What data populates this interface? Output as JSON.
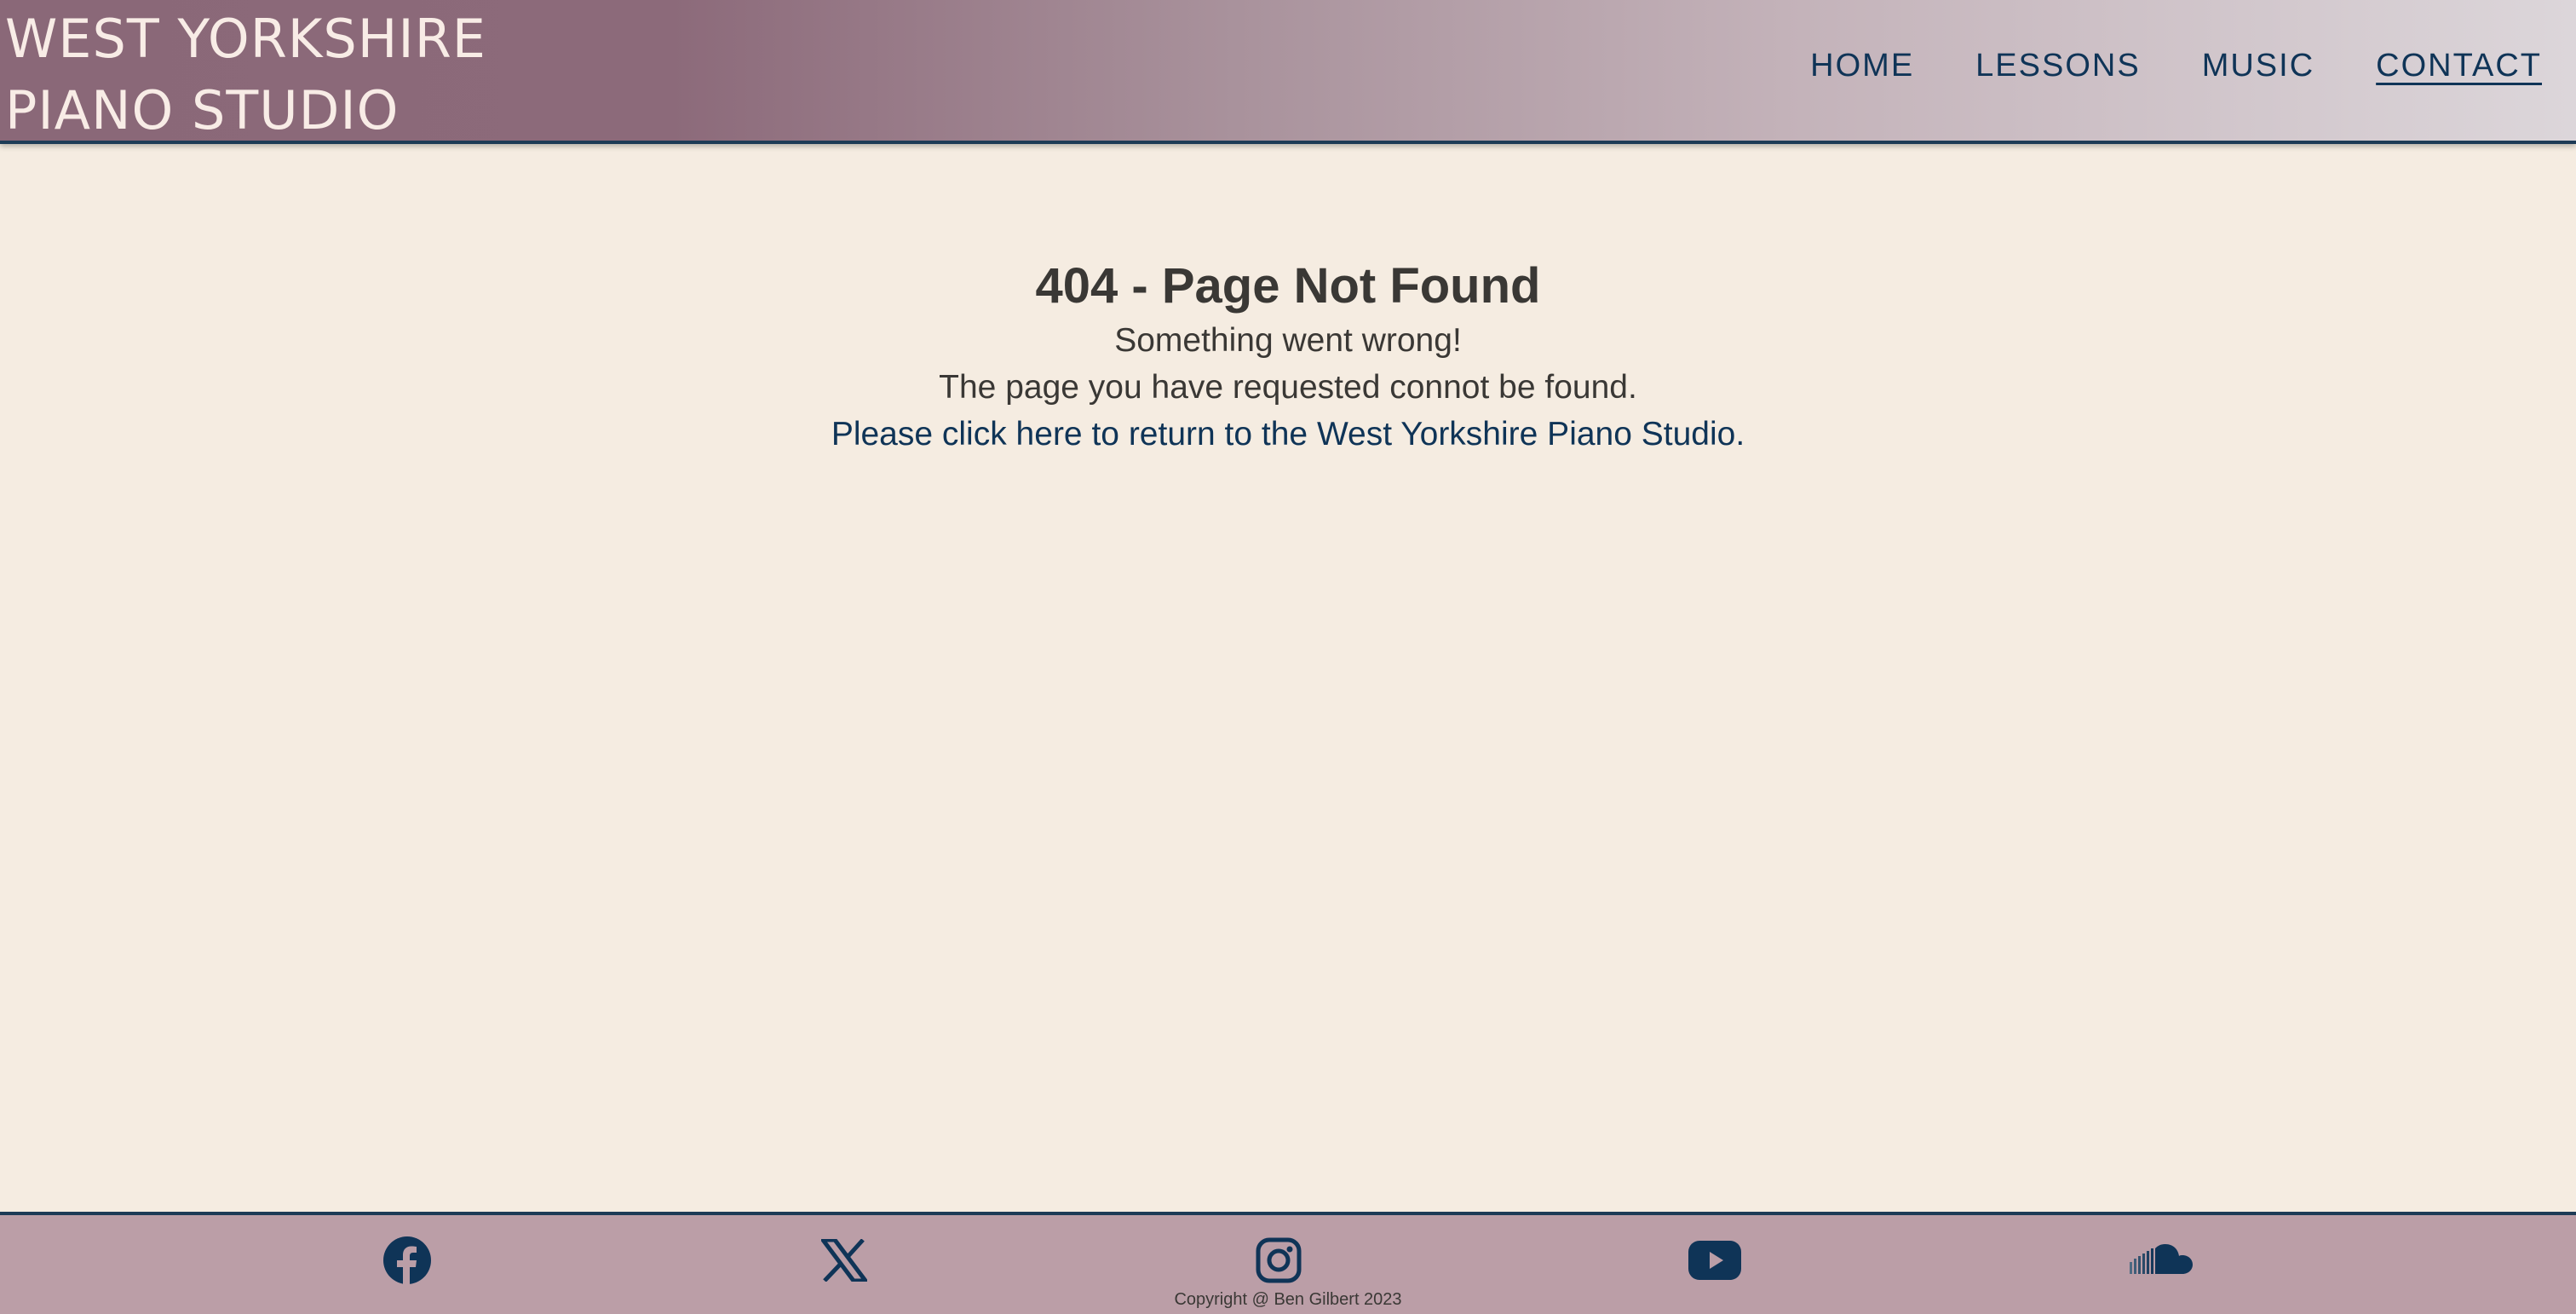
{
  "brand": {
    "line1": "WEST YORKSHIRE",
    "line2": "PIANO STUDIO"
  },
  "nav": {
    "home": "HOME",
    "lessons": "LESSONS",
    "music": "MUSIC",
    "contact": "CONTACT"
  },
  "main": {
    "title": "404 - Page Not Found",
    "line1": "Something went wrong!",
    "line2": "The page you have requested connot be found.",
    "link": "Please click here to return to the West Yorkshire Piano Studio."
  },
  "footer": {
    "icons": [
      "facebook-icon",
      "x-icon",
      "instagram-icon",
      "youtube-icon",
      "soundcloud-icon"
    ],
    "copyright": "Copyright @ Ben Gilbert 2023"
  },
  "colors": {
    "accent": "#0f3457",
    "background": "#f5ece1",
    "footer": "#bb9ea7",
    "text": "#3a3835"
  }
}
